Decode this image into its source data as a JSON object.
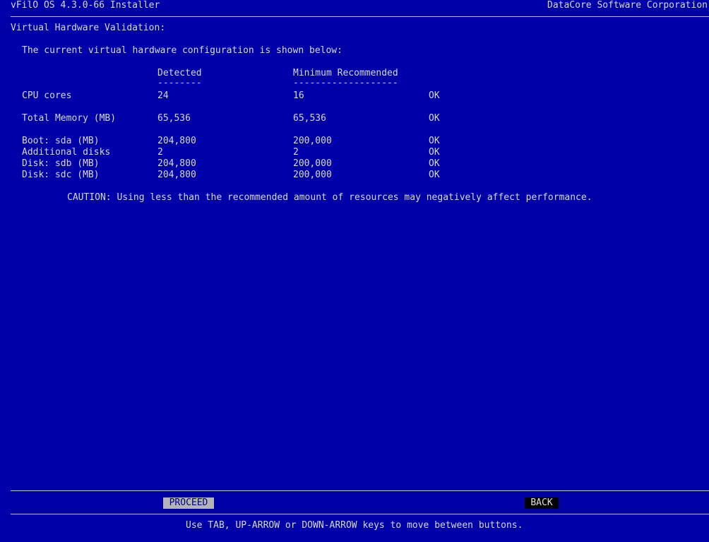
{
  "header": {
    "app_title": "vFilO OS 4.3.0-66 Installer",
    "vendor": "DataCore Software Corporation"
  },
  "page": {
    "title": "Virtual Hardware Validation:",
    "intro": "The current virtual hardware configuration is shown below:"
  },
  "table": {
    "headers": {
      "detected": "Detected",
      "detected_underline": "--------",
      "minimum": "Minimum Recommended",
      "minimum_underline": "-------------------"
    },
    "rows": [
      {
        "label": "CPU cores",
        "detected": "24",
        "minimum": "16",
        "status": "OK"
      },
      {
        "label": "Total Memory (MB)",
        "detected": "65,536",
        "minimum": "65,536",
        "status": "OK"
      },
      {
        "label": "Boot: sda (MB)",
        "detected": "204,800",
        "minimum": "200,000",
        "status": "OK"
      },
      {
        "label": "Additional disks",
        "detected": "2",
        "minimum": "2",
        "status": "OK"
      },
      {
        "label": "Disk: sdb (MB)",
        "detected": "204,800",
        "minimum": "200,000",
        "status": "OK"
      },
      {
        "label": "Disk: sdc (MB)",
        "detected": "204,800",
        "minimum": "200,000",
        "status": "OK"
      }
    ]
  },
  "caution": "CAUTION: Using less than the recommended amount of resources may negatively affect performance.",
  "buttons": {
    "proceed": "PROCEED",
    "back": "BACK"
  },
  "footer": {
    "hint": "Use TAB, UP-ARROW or DOWN-ARROW keys to move between buttons."
  },
  "colors": {
    "background": "#0000a8",
    "text": "#d8d8d8",
    "button_selected_bg": "#b4b4b4",
    "button_unselected_bg": "#000000"
  }
}
